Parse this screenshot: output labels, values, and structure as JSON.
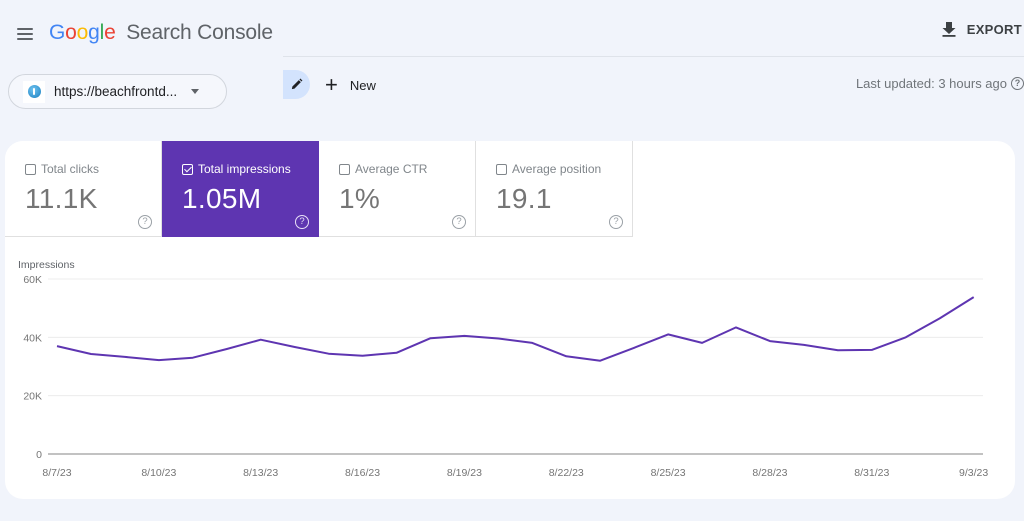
{
  "header": {
    "menu_icon": "hamburger-menu-icon",
    "logo_letters": [
      "G",
      "o",
      "o",
      "g",
      "l",
      "e"
    ],
    "logo_colors": [
      "#4285f4",
      "#ea4335",
      "#fbbc05",
      "#4285f4",
      "#34a853",
      "#ea4335"
    ],
    "product_name": "Search Console",
    "export_label": "EXPORT",
    "export_icon": "download-icon"
  },
  "toolbar": {
    "property_url": "https://beachfrontd...",
    "property_icon": "site-favicon-icon",
    "edit_icon": "pencil-icon",
    "new_label": "New",
    "new_icon": "plus-icon",
    "last_updated": "Last updated: 3 hours ago",
    "help_glyph": "?"
  },
  "metrics": [
    {
      "label": "Total clicks",
      "value": "11.1K",
      "checked": false,
      "help": "?"
    },
    {
      "label": "Total impressions",
      "value": "1.05M",
      "checked": true,
      "help": "?"
    },
    {
      "label": "Average CTR",
      "value": "1%",
      "checked": false,
      "help": "?"
    },
    {
      "label": "Average position",
      "value": "19.1",
      "checked": false,
      "help": "?"
    }
  ],
  "colors": {
    "accent": "#5e35b1",
    "line": "#5e35b1",
    "page_bg": "#f1f4fb"
  },
  "chart_data": {
    "type": "line",
    "title": "",
    "ylabel": "Impressions",
    "xlabel": "",
    "ylim": [
      0,
      60000
    ],
    "y_ticks": [
      0,
      20000,
      40000,
      60000
    ],
    "y_tick_labels": [
      "0",
      "20K",
      "40K",
      "60K"
    ],
    "grid": true,
    "legend": "none",
    "x_tick_labels": [
      "8/7/23",
      "8/10/23",
      "8/13/23",
      "8/16/23",
      "8/19/23",
      "8/22/23",
      "8/25/23",
      "8/28/23",
      "8/31/23",
      "9/3/23"
    ],
    "x": [
      "8/7/23",
      "8/8/23",
      "8/9/23",
      "8/10/23",
      "8/11/23",
      "8/12/23",
      "8/13/23",
      "8/14/23",
      "8/15/23",
      "8/16/23",
      "8/17/23",
      "8/18/23",
      "8/19/23",
      "8/20/23",
      "8/21/23",
      "8/22/23",
      "8/23/23",
      "8/24/23",
      "8/25/23",
      "8/26/23",
      "8/27/23",
      "8/28/23",
      "8/29/23",
      "8/30/23",
      "8/31/23",
      "9/1/23",
      "9/2/23",
      "9/3/23"
    ],
    "series": [
      {
        "name": "Impressions",
        "values": [
          37000,
          34300,
          33300,
          32200,
          33000,
          36000,
          39200,
          36700,
          34400,
          33700,
          34700,
          39700,
          40500,
          39600,
          38100,
          33500,
          32000,
          36400,
          41000,
          38100,
          43400,
          38700,
          37400,
          35600,
          35700,
          40000,
          46500,
          53800
        ]
      }
    ]
  }
}
